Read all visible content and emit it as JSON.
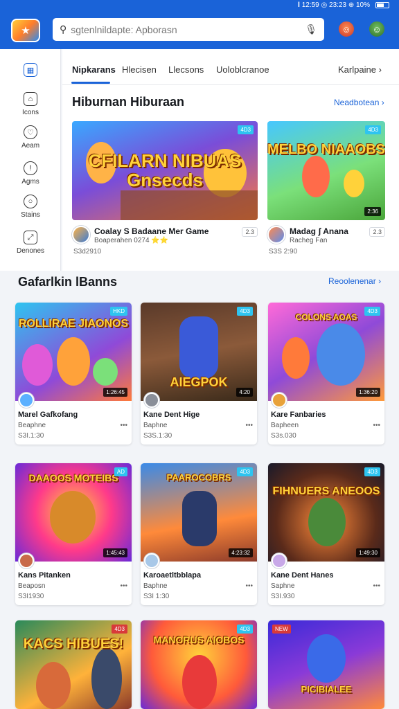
{
  "status_bar": {
    "text": "𝐈 12:59 ◎ 23:23 ⊕ 10%"
  },
  "header": {
    "search_placeholder": "sgtenlnildapte: Apborasn",
    "mic_icon": "mic-icon",
    "profile_a_icon": "avatar-icon",
    "profile_b_icon": "avatar-icon"
  },
  "sidebar": {
    "items": [
      {
        "label": "",
        "icon": "calendar-icon"
      },
      {
        "label": "Icons",
        "icon": "home-icon"
      },
      {
        "label": "Aeam",
        "icon": "heart-icon"
      },
      {
        "label": "Agms",
        "icon": "info-icon"
      },
      {
        "label": "Stains",
        "icon": "bell-icon"
      },
      {
        "label": "Denones",
        "icon": "expand-icon"
      }
    ]
  },
  "tabs": {
    "items": [
      "Nipkarans",
      "Hlecisen",
      "Llecsons",
      "Uoloblcranoe"
    ],
    "more": "Karlpaine"
  },
  "featured": {
    "title": "Hiburnan Hiburaan",
    "see_more": "Neadbotean",
    "cards": [
      {
        "thumb_title": "CFILARN NIBUAS Gnsecds",
        "badge": "4D3",
        "title": "Coalay S Badaane Mer Game",
        "subtitle": "Boaperahen 0274 ⭐⭐",
        "views": "S3d2910",
        "pill": "2.3"
      },
      {
        "thumb_title": "MELBO NIAAOBS",
        "badge": "4D3",
        "duration": "2:36",
        "title": "Madag ʃ Anana",
        "subtitle": "Racheg Fan",
        "views": "S3S 2:90",
        "pill": "2.3"
      }
    ]
  },
  "grid_section": {
    "title": "Gafarlkin lBanns",
    "see_more": "Reoolenenar",
    "cards": [
      {
        "thumb_title": "ROLLIRAE JIAONOS",
        "badge": "HKD",
        "duration": "1:26:45",
        "title": "Marel Gafkofang",
        "subtitle": "Beaphne",
        "views": "S3I.1:30"
      },
      {
        "thumb_title": "AIEGPOK",
        "badge": "4D3",
        "duration": "4:20",
        "title": "Kane Dent Hige",
        "subtitle": "Baphne",
        "views": "S3S.1:30"
      },
      {
        "thumb_title": "COLONS AOAS",
        "badge": "4D3",
        "duration": "1:36:20",
        "title": "Kare Fanbaries",
        "subtitle": "Bapheen",
        "views": "S3s.030"
      },
      {
        "thumb_title": "DAAOOS MOTEIBS",
        "badge": "AD",
        "duration": "1:45:43",
        "title": "Kans Pitanken",
        "subtitle": "Beaposn",
        "views": "S3I1930"
      },
      {
        "thumb_title": "PAAROCOBRS",
        "badge": "4D3",
        "duration": "4:23:32",
        "title": "Karoaetltbblapa",
        "subtitle": "Baphne",
        "views": "S3I 1:30"
      },
      {
        "thumb_title": "FIHNUERS ANEOOS",
        "badge": "4D3",
        "duration": "1:49:30",
        "title": "Kane Dent Hanes",
        "subtitle": "Saphne",
        "views": "S3I.930"
      },
      {
        "thumb_title": "KACS HIBUES!",
        "badge": "4D3",
        "duration": "",
        "title": "",
        "subtitle": "",
        "views": ""
      },
      {
        "thumb_title": "MANORUS AIOBOS",
        "badge": "4D3",
        "duration": "",
        "title": "",
        "subtitle": "",
        "views": ""
      },
      {
        "thumb_title": "PICIBIALEE",
        "badge": "NEW",
        "duration": "",
        "title": "",
        "subtitle": "",
        "views": ""
      }
    ]
  },
  "colors": {
    "accent": "#1a63d8",
    "background": "#f2f4f8"
  }
}
